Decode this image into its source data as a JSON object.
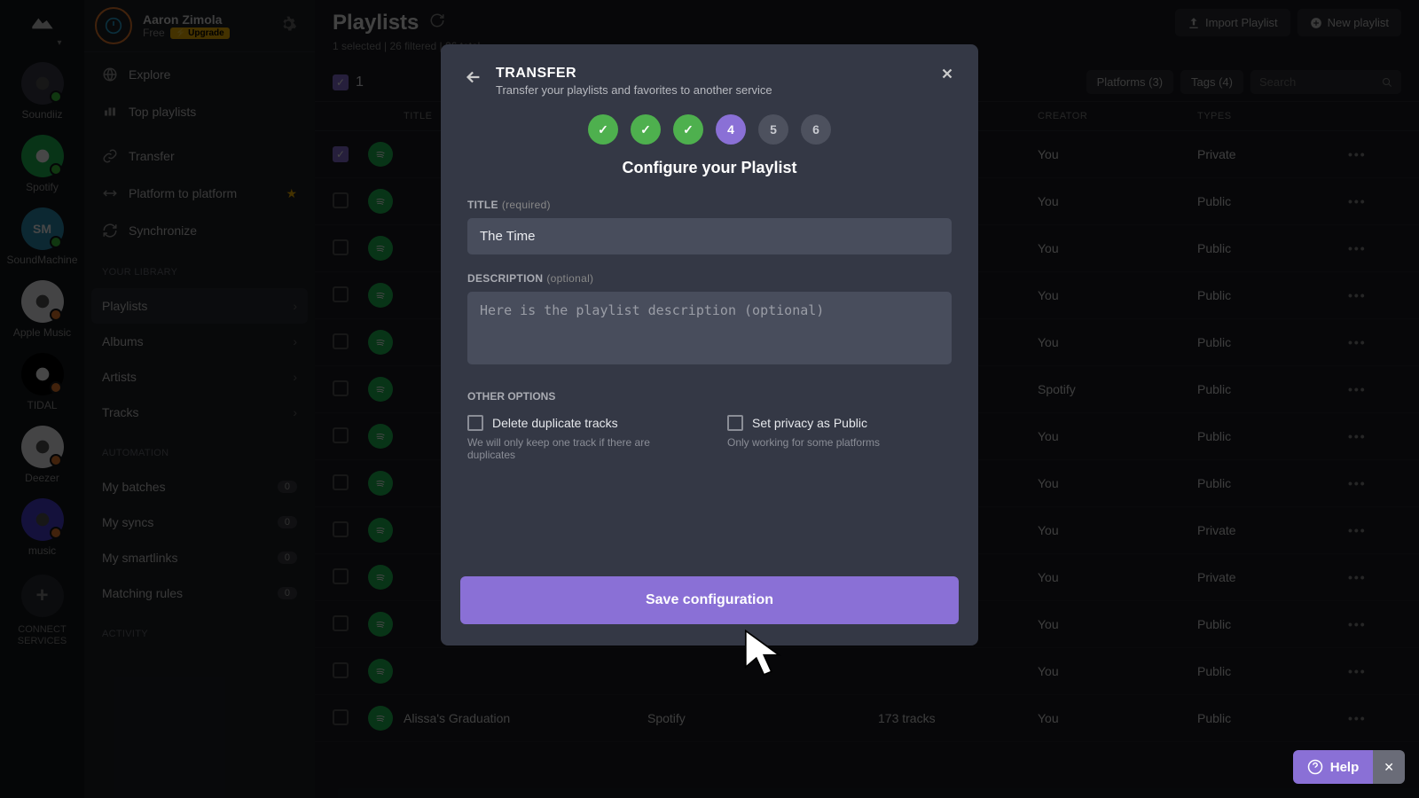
{
  "rail": {
    "brand": "Soundiiz",
    "items": [
      {
        "label": "Soundiiz",
        "bg": "#3a3c48",
        "dot": "green"
      },
      {
        "label": "Spotify",
        "bg": "#1db954",
        "dot": "green"
      },
      {
        "label": "SoundMachine",
        "bg": "#2d8fb5",
        "text": "SM",
        "dot": "green"
      },
      {
        "label": "Apple Music",
        "bg": "#f5f5f7",
        "dot": "orange"
      },
      {
        "label": "TIDAL",
        "bg": "#000000",
        "dot": "orange"
      },
      {
        "label": "Deezer",
        "bg": "#f5f5f7",
        "dot": "orange"
      },
      {
        "label": "music",
        "bg": "#4a3fd4",
        "dot": "orange"
      }
    ],
    "connect": "CONNECT SERVICES"
  },
  "user": {
    "name": "Aaron Zimola",
    "plan": "Free",
    "upgrade": "Upgrade"
  },
  "nav": {
    "top": [
      {
        "label": "Explore",
        "icon": "globe"
      },
      {
        "label": "Top playlists",
        "icon": "bars"
      }
    ],
    "tools": [
      {
        "label": "Transfer",
        "icon": "link"
      },
      {
        "label": "Platform to platform",
        "icon": "swap",
        "star": true
      },
      {
        "label": "Synchronize",
        "icon": "sync"
      }
    ],
    "library_label": "YOUR LIBRARY",
    "library": [
      {
        "label": "Playlists",
        "active": true,
        "chev": true
      },
      {
        "label": "Albums",
        "chev": true
      },
      {
        "label": "Artists",
        "chev": true
      },
      {
        "label": "Tracks",
        "chev": true
      }
    ],
    "automation_label": "AUTOMATION",
    "automation": [
      {
        "label": "My batches",
        "count": "0"
      },
      {
        "label": "My syncs",
        "count": "0"
      },
      {
        "label": "My smartlinks",
        "count": "0"
      },
      {
        "label": "Matching rules",
        "count": "0"
      }
    ],
    "activity_label": "ACTIVITY"
  },
  "page": {
    "title": "Playlists",
    "sub": "1 selected | 26 filtered | 26 total",
    "import": "Import Playlist",
    "new": "New playlist"
  },
  "toolbar": {
    "one": "1",
    "filters": {
      "platforms": "Platforms (3)",
      "tags": "Tags (4)",
      "search_placeholder": "Search"
    }
  },
  "columns": {
    "title": "TITLE",
    "creator": "CREATOR",
    "types": "TYPES"
  },
  "rows": [
    {
      "checked": true,
      "title": "",
      "platform": "",
      "tracks": "",
      "creator": "You",
      "type": "Private"
    },
    {
      "checked": false,
      "title": "",
      "platform": "",
      "tracks": "",
      "creator": "You",
      "type": "Public"
    },
    {
      "checked": false,
      "title": "",
      "platform": "",
      "tracks": "",
      "creator": "You",
      "type": "Public"
    },
    {
      "checked": false,
      "title": "",
      "platform": "",
      "tracks": "",
      "creator": "You",
      "type": "Public"
    },
    {
      "checked": false,
      "title": "",
      "platform": "",
      "tracks": "",
      "creator": "You",
      "type": "Public"
    },
    {
      "checked": false,
      "title": "",
      "platform": "",
      "tracks": "",
      "creator": "Spotify",
      "type": "Public"
    },
    {
      "checked": false,
      "title": "",
      "platform": "",
      "tracks": "",
      "creator": "You",
      "type": "Public"
    },
    {
      "checked": false,
      "title": "",
      "platform": "",
      "tracks": "",
      "creator": "You",
      "type": "Public"
    },
    {
      "checked": false,
      "title": "",
      "platform": "",
      "tracks": "",
      "creator": "You",
      "type": "Private"
    },
    {
      "checked": false,
      "title": "",
      "platform": "",
      "tracks": "",
      "creator": "You",
      "type": "Private"
    },
    {
      "checked": false,
      "title": "",
      "platform": "",
      "tracks": "",
      "creator": "You",
      "type": "Public"
    },
    {
      "checked": false,
      "title": "",
      "platform": "",
      "tracks": "",
      "creator": "You",
      "type": "Public"
    },
    {
      "checked": false,
      "title": "Alissa's Graduation",
      "platform": "Spotify",
      "tracks": "173 tracks",
      "creator": "You",
      "type": "Public"
    }
  ],
  "modal": {
    "title": "TRANSFER",
    "subtitle": "Transfer your playlists and favorites to another service",
    "steps": [
      "✓",
      "✓",
      "✓",
      "4",
      "5",
      "6"
    ],
    "step_states": [
      "done",
      "done",
      "done",
      "active",
      "pending",
      "pending"
    ],
    "heading": "Configure your Playlist",
    "title_label": "TITLE",
    "title_req": "(required)",
    "title_value": "The Time",
    "desc_label": "DESCRIPTION",
    "desc_req": "(optional)",
    "desc_placeholder": "Here is the playlist description (optional)",
    "options_label": "OTHER OPTIONS",
    "opt1": {
      "label": "Delete duplicate tracks",
      "hint": "We will only keep one track if there are duplicates"
    },
    "opt2": {
      "label": "Set privacy as Public",
      "hint": "Only working for some platforms"
    },
    "save": "Save configuration"
  },
  "help": {
    "label": "Help",
    "close": "✕"
  }
}
